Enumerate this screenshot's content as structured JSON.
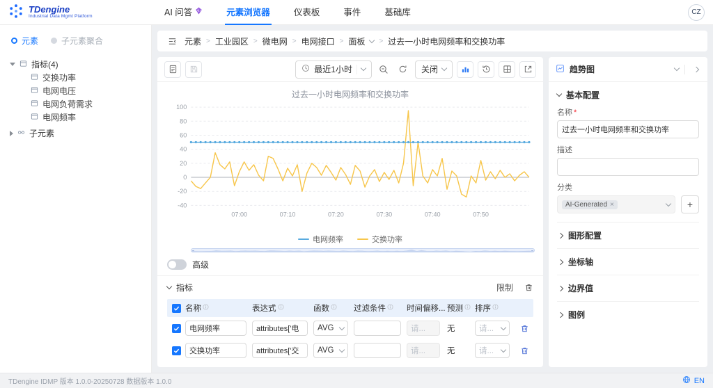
{
  "colors": {
    "primary": "#1677ff",
    "table_header_bg": "#e9f1fc"
  },
  "app": {
    "brand": "TDengine",
    "brand_sub": "Industrial Data Mgmt Platform",
    "nav": [
      {
        "label": "AI 问答"
      },
      {
        "label": "元素浏览器"
      },
      {
        "label": "仪表板"
      },
      {
        "label": "事件"
      },
      {
        "label": "基础库"
      }
    ],
    "avatar": "CZ"
  },
  "sidebar": {
    "tab_element": "元素",
    "tab_aggregate": "子元素聚合",
    "metrics_group": "指标(4)",
    "metrics": [
      "交换功率",
      "电网电压",
      "电网负荷需求",
      "电网频率"
    ],
    "sub_element": "子元素"
  },
  "breadcrumb": {
    "separator": ">",
    "items": [
      "元素",
      "工业园区",
      "微电网",
      "电网接口",
      "面板",
      "过去一小时电网频率和交换功率"
    ]
  },
  "toolbar": {
    "time_range": "最近1小时",
    "close_label": "关闭"
  },
  "chart_section": {
    "advanced_label": "高级",
    "metrics_title": "指标",
    "limit_label": "限制"
  },
  "metrics_table": {
    "headers": [
      "名称",
      "表达式",
      "函数",
      "过滤条件",
      "时间偏移...",
      "预测",
      "排序"
    ],
    "rows": [
      {
        "name": "电网频率",
        "expr": "attributes['电",
        "func": "AVG",
        "filter": "",
        "offset": "请...",
        "forecast": "无",
        "sort": "请..."
      },
      {
        "name": "交换功率",
        "expr": "attributes['交",
        "func": "AVG",
        "filter": "",
        "offset": "请...",
        "forecast": "无",
        "sort": "请..."
      }
    ]
  },
  "right_panel": {
    "title": "趋势图",
    "basic_section": "基本配置",
    "name_label": "名称",
    "required_mark": "*",
    "name_value": "过去一小时电网频率和交换功率",
    "desc_label": "描述",
    "category_label": "分类",
    "category_tag": "AI-Generated",
    "tag_close": "×",
    "add_button": "+",
    "collapsed": [
      "图形配置",
      "坐标轴",
      "边界值",
      "图例"
    ]
  },
  "statusbar": {
    "version": "TDengine IDMP 版本 1.0.0-20250728 数据版本 1.0.0",
    "lang": "EN"
  },
  "chart_data": {
    "type": "line",
    "title": "过去一小时电网频率和交换功率",
    "xlabel": "",
    "ylabel": "",
    "ylim": [
      -40,
      100
    ],
    "y_ticks": [
      -40,
      -20,
      0,
      20,
      40,
      60,
      80,
      100
    ],
    "x_ticks": [
      "07:00",
      "07:10",
      "07:20",
      "07:30",
      "07:40",
      "07:50"
    ],
    "x_tick_indices": [
      10,
      20,
      30,
      40,
      50,
      60
    ],
    "grid": "dashed-horizontal",
    "legend_position": "bottom",
    "series": [
      {
        "name": "电网频率",
        "color": "#58aadf",
        "markers": true,
        "values": [
          50,
          50,
          50,
          50,
          50,
          50,
          50,
          50,
          50,
          50,
          50,
          50,
          50,
          50,
          50,
          50,
          50,
          50,
          50,
          50,
          50,
          50,
          50,
          50,
          50,
          50,
          50,
          50,
          50,
          50,
          50,
          50,
          50,
          50,
          50,
          50,
          50,
          50,
          50,
          50,
          50,
          50,
          50,
          50,
          50,
          50,
          50,
          50,
          50,
          50,
          50,
          50,
          50,
          50,
          50,
          50,
          50,
          50,
          50,
          50,
          50,
          50,
          50,
          50,
          50,
          50,
          50,
          50,
          50,
          50,
          50
        ]
      },
      {
        "name": "交换功率",
        "color": "#f7c64b",
        "markers": false,
        "values": [
          -5,
          -13,
          -16,
          -8,
          0,
          35,
          18,
          12,
          22,
          -12,
          8,
          22,
          10,
          18,
          3,
          -5,
          30,
          27,
          12,
          -5,
          13,
          2,
          18,
          -20,
          6,
          20,
          14,
          3,
          17,
          7,
          -4,
          14,
          4,
          -10,
          17,
          9,
          -14,
          2,
          11,
          -6,
          7,
          -3,
          10,
          -8,
          20,
          95,
          -12,
          50,
          2,
          -8,
          11,
          2,
          27,
          -17,
          9,
          2,
          -24,
          -28,
          2,
          -8,
          24,
          -4,
          8,
          -2,
          10,
          0,
          5,
          -5,
          3,
          8,
          0
        ]
      }
    ]
  }
}
